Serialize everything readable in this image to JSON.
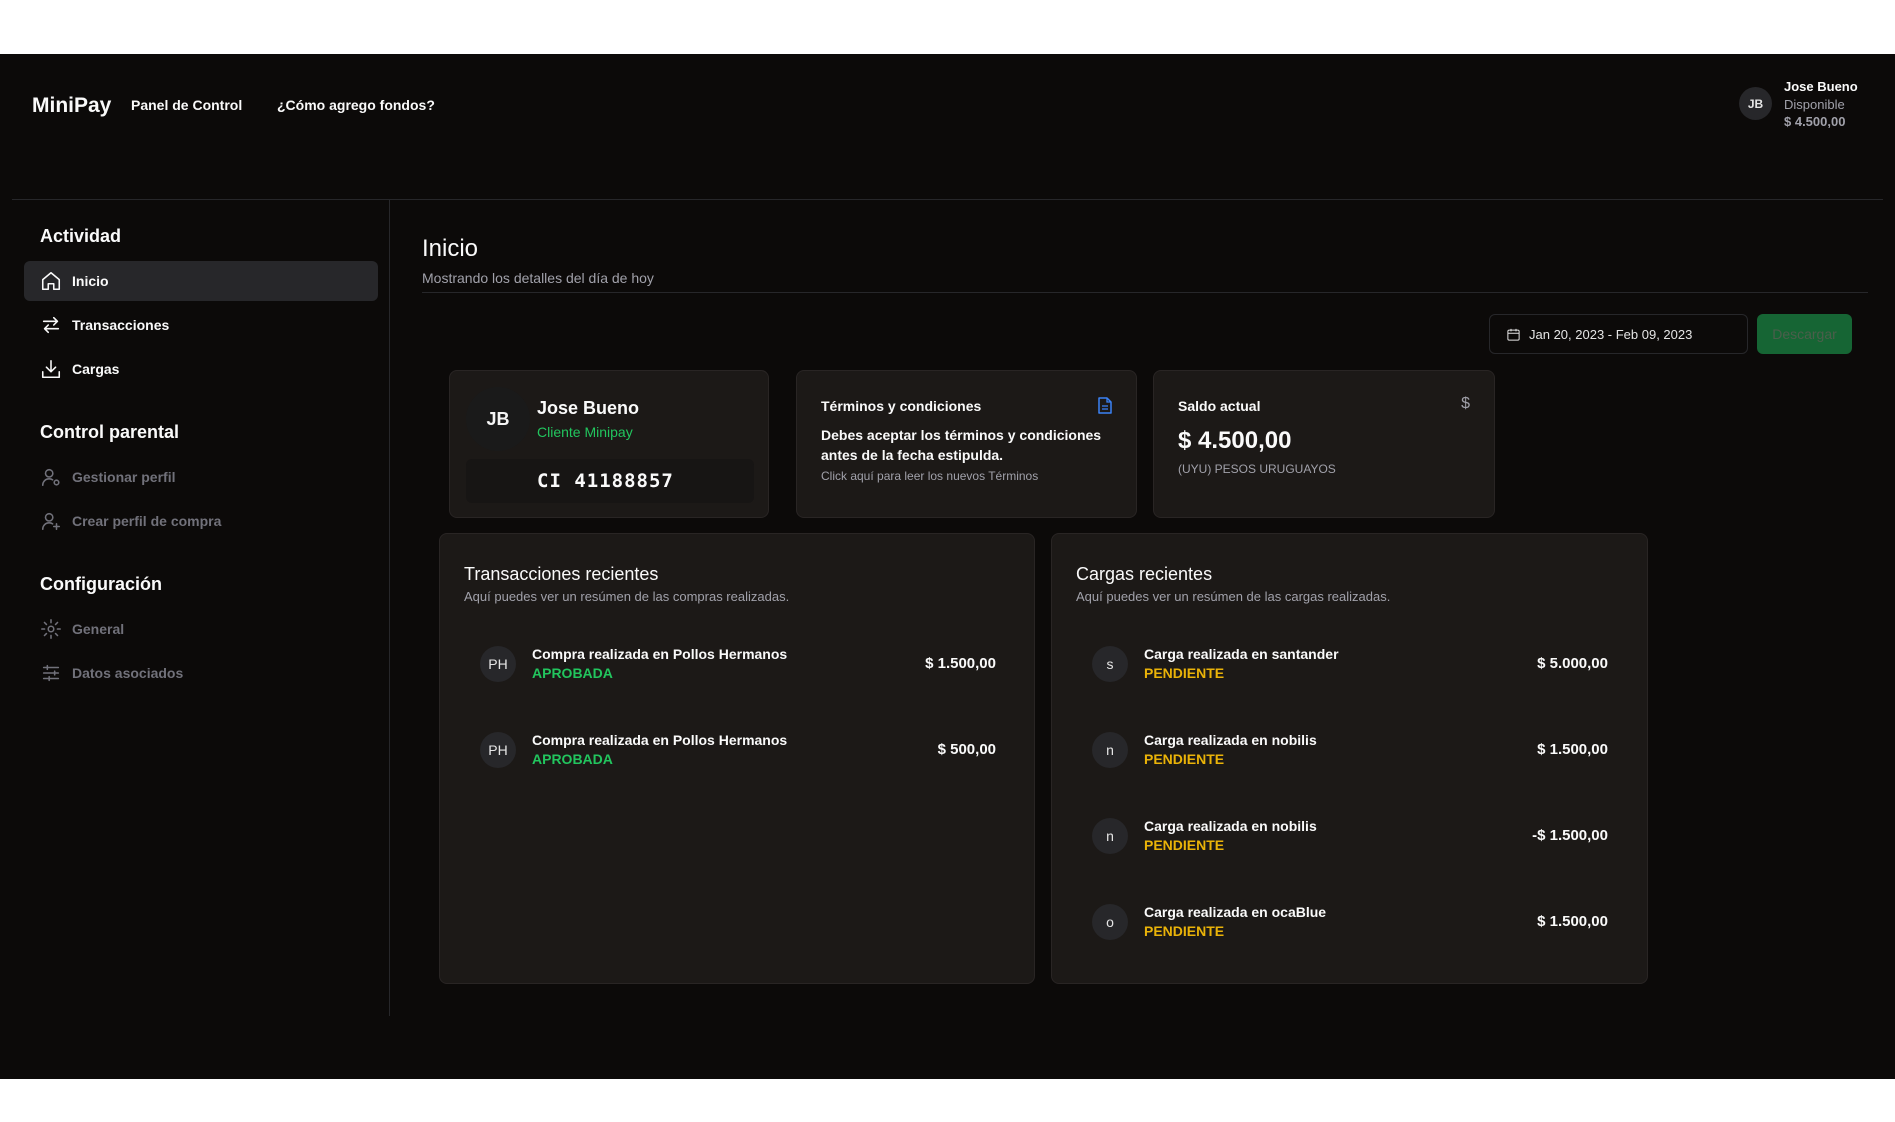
{
  "header": {
    "brand": "MiniPay",
    "nav": [
      "Panel de Control",
      "¿Cómo agrego fondos?"
    ],
    "user": {
      "initials": "JB",
      "name": "Jose Bueno",
      "available_label": "Disponible",
      "balance": "$ 4.500,00"
    }
  },
  "sidebar": {
    "sections": [
      {
        "heading": "Actividad",
        "items": [
          {
            "label": "Inicio",
            "icon": "home-icon",
            "active": true
          },
          {
            "label": "Transacciones",
            "icon": "arrows-exchange-icon"
          },
          {
            "label": "Cargas",
            "icon": "download-icon"
          }
        ]
      },
      {
        "heading": "Control parental",
        "items": [
          {
            "label": "Gestionar perfil",
            "icon": "user-settings-icon",
            "disabled": true
          },
          {
            "label": "Crear perfil de compra",
            "icon": "user-plus-icon",
            "disabled": true
          }
        ]
      },
      {
        "heading": "Configuración",
        "items": [
          {
            "label": "General",
            "icon": "gear-icon",
            "disabled": true
          },
          {
            "label": "Datos asociados",
            "icon": "sliders-icon",
            "disabled": true
          }
        ]
      }
    ]
  },
  "main": {
    "title": "Inicio",
    "subtitle": "Mostrando los detalles del día de hoy",
    "date_range": "Jan 20, 2023 - Feb 09, 2023",
    "download_label": "Descargar",
    "profile_card": {
      "initials": "JB",
      "name": "Jose Bueno",
      "role": "Cliente Minipay",
      "ci": "CI 41188857"
    },
    "terms_card": {
      "title": "Términos y condiciones",
      "body": "Debes aceptar los términos y condiciones antes de la fecha estipulda.",
      "link": "Click aquí para leer los nuevos Términos",
      "icon": "document-icon"
    },
    "balance_card": {
      "title": "Saldo actual",
      "icon": "$",
      "amount": "$ 4.500,00",
      "currency": "(UYU) PESOS URUGUAYOS"
    },
    "transactions": {
      "title": "Transacciones recientes",
      "subtitle": "Aquí puedes ver un resúmen de las compras realizadas.",
      "rows": [
        {
          "avatar": "PH",
          "desc": "Compra realizada en Pollos Hermanos",
          "status": "APROBADA",
          "amount": "$ 1.500,00"
        },
        {
          "avatar": "PH",
          "desc": "Compra realizada en Pollos Hermanos",
          "status": "APROBADA",
          "amount": "$ 500,00"
        }
      ]
    },
    "loads": {
      "title": "Cargas recientes",
      "subtitle": "Aquí puedes ver un resúmen de las cargas realizadas.",
      "rows": [
        {
          "avatar": "s",
          "desc": "Carga realizada en santander",
          "status": "PENDIENTE",
          "amount": "$ 5.000,00"
        },
        {
          "avatar": "n",
          "desc": "Carga realizada en nobilis",
          "status": "PENDIENTE",
          "amount": "$ 1.500,00"
        },
        {
          "avatar": "n",
          "desc": "Carga realizada en nobilis",
          "status": "PENDIENTE",
          "amount": "-$ 1.500,00"
        },
        {
          "avatar": "o",
          "desc": "Carga realizada en ocaBlue",
          "status": "PENDIENTE",
          "amount": "$ 1.500,00"
        }
      ]
    }
  },
  "colors": {
    "background": "#0c0a09",
    "card": "#1c1917",
    "approved": "#22c55e",
    "pending": "#eab308",
    "download_button": "#166534",
    "document_icon": "#3b82f6"
  }
}
